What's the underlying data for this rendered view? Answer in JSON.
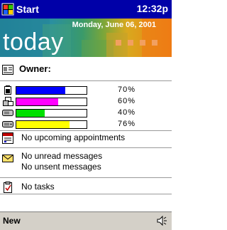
{
  "titlebar": {
    "start_label": "Start",
    "clock": "12:32p"
  },
  "banner": {
    "date": "Monday, June 06, 2001",
    "today": "today"
  },
  "owner": {
    "label": "Owner:"
  },
  "status": [
    {
      "icon": "battery-icon",
      "percent_label": "70%",
      "value": 0.7,
      "color": "#0000ff"
    },
    {
      "icon": "backup-battery-icon",
      "percent_label": "60%",
      "value": 0.6,
      "color": "#ff00ff"
    },
    {
      "icon": "main-memory-icon",
      "percent_label": "40%",
      "value": 0.4,
      "color": "#00e000"
    },
    {
      "icon": "storage-card-icon",
      "percent_label": "76%",
      "value": 0.76,
      "color": "#ffff00"
    }
  ],
  "calendar": {
    "text": "No upcoming appointments"
  },
  "inbox": {
    "line1": "No unread messages",
    "line2": "No unsent messages"
  },
  "tasks": {
    "text": "No tasks"
  },
  "bottombar": {
    "new_label": "New"
  }
}
